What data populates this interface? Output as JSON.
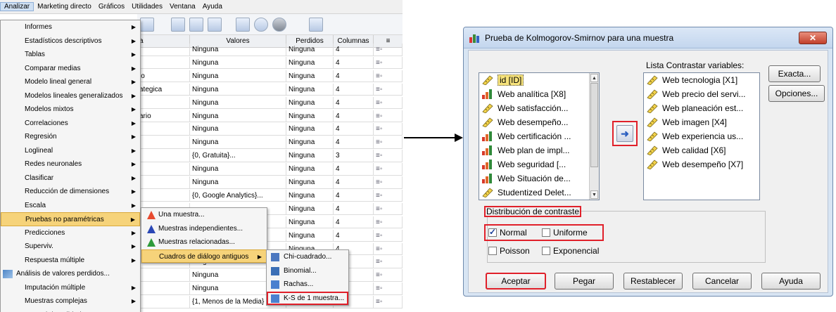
{
  "spss": {
    "menubar": [
      "Analizar",
      "Marketing directo",
      "Gráficos",
      "Utilidades",
      "Ventana",
      "Ayuda"
    ],
    "grid_headers": [
      "a",
      "Valores",
      "Perdidos",
      "Columnas"
    ],
    "grid_rows": [
      {
        "name": "",
        "values": "Ninguna",
        "missing": "Ninguna",
        "cols": "4"
      },
      {
        "name": "",
        "values": "Ninguna",
        "missing": "Ninguna",
        "cols": "4"
      },
      {
        "name": "io",
        "values": "Ninguna",
        "missing": "Ninguna",
        "cols": "4"
      },
      {
        "name": "ategica",
        "values": "Ninguna",
        "missing": "Ninguna",
        "cols": "4"
      },
      {
        "name": "",
        "values": "Ninguna",
        "missing": "Ninguna",
        "cols": "4"
      },
      {
        "name": "ario",
        "values": "Ninguna",
        "missing": "Ninguna",
        "cols": "4"
      },
      {
        "name": "",
        "values": "Ninguna",
        "missing": "Ninguna",
        "cols": "4"
      },
      {
        "name": "",
        "values": "Ninguna",
        "missing": "Ninguna",
        "cols": "4"
      },
      {
        "name": "",
        "values": "{0, Gratuita}...",
        "missing": "Ninguna",
        "cols": "3"
      },
      {
        "name": "",
        "values": "Ninguna",
        "missing": "Ninguna",
        "cols": "4"
      },
      {
        "name": "",
        "values": "Ninguna",
        "missing": "Ninguna",
        "cols": "4"
      },
      {
        "name": "",
        "values": "{0, Google Analytics}...",
        "missing": "Ninguna",
        "cols": "4"
      },
      {
        "name": "",
        "values": "",
        "missing": "Ninguna",
        "cols": "4"
      },
      {
        "name": "",
        "values": "",
        "missing": "Ninguna",
        "cols": "4"
      },
      {
        "name": "",
        "values": "",
        "missing": "Ninguna",
        "cols": "4"
      },
      {
        "name": "",
        "values": "",
        "missing": "Ninguna",
        "cols": "4"
      },
      {
        "name": "% de los ca...",
        "values": "Ninguna",
        "missing": "",
        "cols": ""
      },
      {
        "name": "",
        "values": "Ninguna",
        "missing": "Ninguna",
        "cols": "4"
      },
      {
        "name": "",
        "values": "Ninguna",
        "missing": "Ninguna",
        "cols": "4"
      },
      {
        "name": "",
        "values": "{1, Menos de la Media}",
        "missing": "",
        "cols": ""
      }
    ],
    "analyze_menu": [
      "Informes",
      "Estadísticos descriptivos",
      "Tablas",
      "Comparar medias",
      "Modelo lineal general",
      "Modelos lineales generalizados",
      "Modelos mixtos",
      "Correlaciones",
      "Regresión",
      "Loglineal",
      "Redes neuronales",
      "Clasificar",
      "Reducción de dimensiones",
      "Escala",
      "Pruebas no paramétricas",
      "Predicciones",
      "Superviv.",
      "Respuesta múltiple",
      "Análisis de valores perdidos...",
      "Imputación múltiple",
      "Muestras complejas",
      "Control de calidad"
    ],
    "nonparam_menu": [
      "Una muestra...",
      "Muestras independientes...",
      "Muestras relacionadas...",
      "Cuadros de diálogo antiguos"
    ],
    "legacy_menu": [
      "Chi-cuadrado...",
      "Binomial...",
      "Rachas...",
      "K-S de 1 muestra..."
    ]
  },
  "dialog": {
    "title": "Prueba de Kolmogorov-Smirnov para una muestra",
    "close": "✕",
    "source_vars": [
      "id [ID]",
      "Web analítica [X8]",
      "Web satisfacción...",
      "Web desempeño...",
      "Web certificación ...",
      "Web plan de impl...",
      "Web seguridad [...",
      "Web Situación de...",
      "Studentized Delet..."
    ],
    "test_list_label": "Lista Contrastar variables:",
    "test_vars": [
      "Web tecnologia [X1]",
      "Web precio del servi...",
      "Web planeación est...",
      "Web imagen  [X4]",
      "Web experiencia us...",
      "Web calidad [X6]",
      "Web desempeño [X7]"
    ],
    "side_buttons": [
      "Exacta...",
      "Opciones..."
    ],
    "dist_label": "Distribución de contraste",
    "dist_options": [
      {
        "label": "Normal",
        "checked": true
      },
      {
        "label": "Uniforme",
        "checked": false
      },
      {
        "label": "Poisson",
        "checked": false
      },
      {
        "label": "Exponencial",
        "checked": false
      }
    ],
    "bottom_buttons": [
      "Aceptar",
      "Pegar",
      "Restablecer",
      "Cancelar",
      "Ayuda"
    ]
  },
  "colors": {
    "highlight_red": "#e0202a",
    "menu_hover": "#f6d37a",
    "selection_blue": "#3a78d8"
  }
}
